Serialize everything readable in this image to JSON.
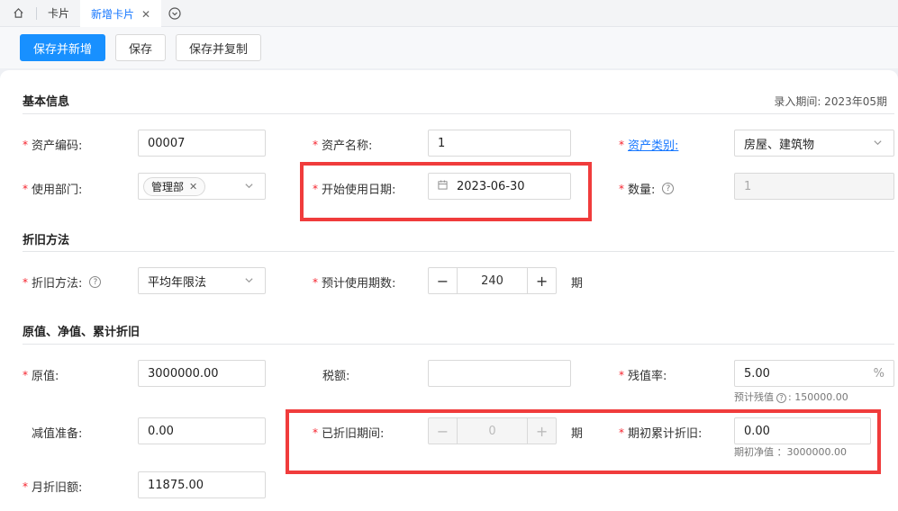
{
  "tabs": {
    "items": [
      {
        "label": "卡片"
      },
      {
        "label": "新增卡片"
      }
    ],
    "close": "✕"
  },
  "toolbar": {
    "save_new": "保存并新增",
    "save": "保存",
    "save_copy": "保存并复制"
  },
  "period": "录入期间: 2023年05期",
  "sections": {
    "basic": "基本信息",
    "depr": "折旧方法",
    "value": "原值、净值、累计折旧"
  },
  "basic": {
    "asset_code_label": "资产编码:",
    "asset_code": "00007",
    "asset_name_label": "资产名称:",
    "asset_name": "1",
    "asset_type_label": "资产类别:",
    "asset_type": "房屋、建筑物",
    "dept_label": "使用部门:",
    "dept_tag": "管理部",
    "start_date_label": "开始使用日期:",
    "start_date": "2023-06-30",
    "qty_label": "数量:",
    "qty": "1"
  },
  "depr": {
    "method_label": "折旧方法:",
    "method": "平均年限法",
    "periods_label": "预计使用期数:",
    "periods": "240",
    "unit": "期"
  },
  "value": {
    "original_label": "原值:",
    "original": "3000000.00",
    "tax_label": "税额:",
    "tax": "",
    "residual_rate_label": "残值率:",
    "residual_rate": "5.00",
    "percent": "%",
    "residual_hint_a": "预计残值",
    "residual_hint_b": ": 150000.00",
    "impair_label": "减值准备:",
    "impair": "0.00",
    "depr_periods_label": "已折旧期间:",
    "depr_periods": "0",
    "unit": "期",
    "init_depr_label": "期初累计折旧:",
    "init_depr": "0.00",
    "net_hint": "期初净值 ：3000000.00",
    "monthly_label": "月折旧额:",
    "monthly": "11875.00"
  },
  "colors": {
    "primary": "#1890ff",
    "required": "#f5222d",
    "highlight": "#f03c3c"
  }
}
